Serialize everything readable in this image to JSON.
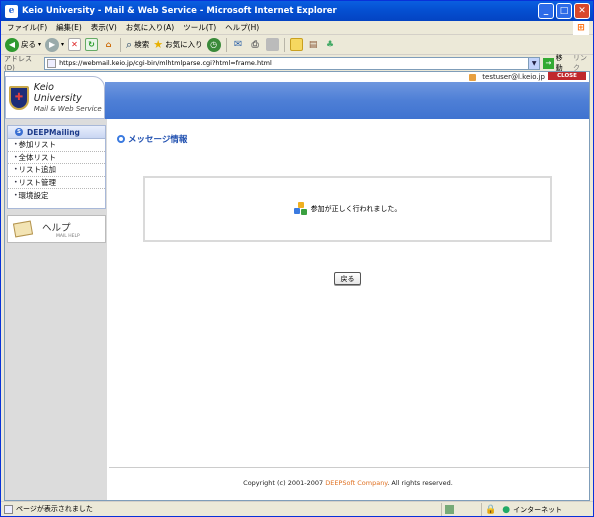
{
  "window": {
    "title": "Keio University - Mail & Web Service - Microsoft Internet Explorer"
  },
  "menu": [
    "ファイル(F)",
    "編集(E)",
    "表示(V)",
    "お気に入り(A)",
    "ツール(T)",
    "ヘルプ(H)"
  ],
  "toolbar": {
    "back": "戻る",
    "search": "検索",
    "favorites": "お気に入り"
  },
  "address": {
    "label": "アドレス(D)",
    "url": "https://webmail.keio.jp/cgi-bin/mlhtmlparse.cgi?html=frame.html",
    "go": "移動",
    "links": "リンク"
  },
  "header": {
    "logo_line1": "Keio University",
    "logo_line2": "Mail & Web Service",
    "user": "testuser@l.keio.jp",
    "close": "CLOSE"
  },
  "sidebar": {
    "title": "DEEPMailing",
    "items": [
      "参加リスト",
      "全体リスト",
      "リスト追加",
      "リスト管理",
      "環境設定"
    ],
    "help_title": "ヘルプ",
    "help_sub": "MAIL HELP"
  },
  "main": {
    "heading": "メッセージ情報",
    "message": "参加が正しく行われました。",
    "back_button": "戻る",
    "footer_prefix": "Copyright (c) 2001-2007 ",
    "footer_company": "DEEPSoft Company",
    "footer_suffix": ". All rights reserved."
  },
  "status": {
    "text": "ページが表示されました",
    "zone": "インターネット"
  }
}
